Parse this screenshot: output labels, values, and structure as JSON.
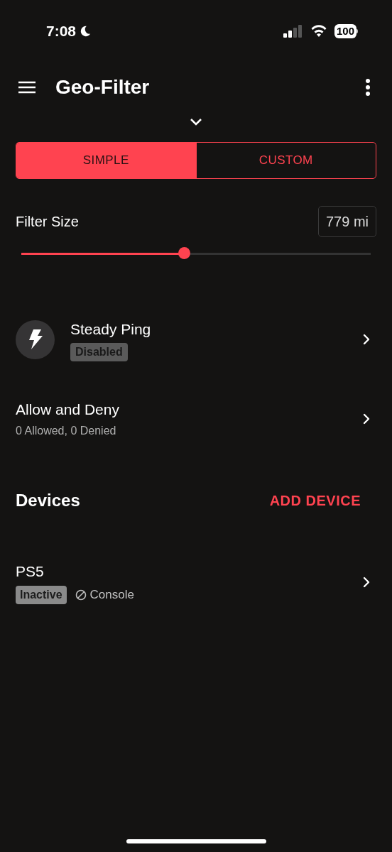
{
  "status_bar": {
    "time": "7:08",
    "battery": "100"
  },
  "header": {
    "title": "Geo-Filter"
  },
  "mode_tabs": [
    {
      "label": "SIMPLE",
      "selected": true
    },
    {
      "label": "CUSTOM",
      "selected": false
    }
  ],
  "filter_size": {
    "label": "Filter Size",
    "value": "779 mi",
    "level": 0.466
  },
  "steady_ping": {
    "title": "Steady Ping",
    "badge": "Disabled"
  },
  "allow_deny": {
    "title": "Allow and Deny",
    "subtitle": "0 Allowed, 0 Denied"
  },
  "devices": {
    "title": "Devices",
    "action": "ADD DEVICE",
    "items": [
      {
        "name": "PS5",
        "badge": "Inactive",
        "type": "Console"
      }
    ]
  }
}
